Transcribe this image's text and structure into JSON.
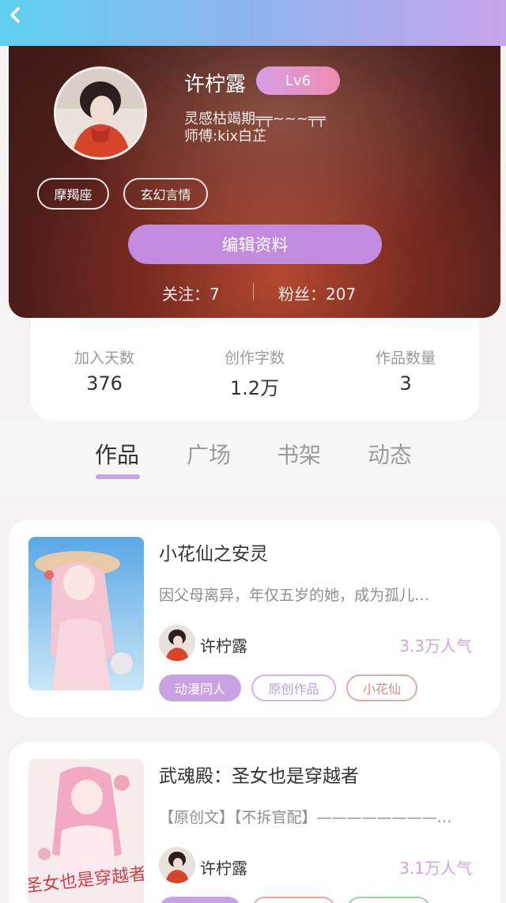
{
  "header": {
    "back_icon": "chevron-left-icon"
  },
  "profile": {
    "nickname": "许柠露",
    "level": "Lv6",
    "bio_line1": "灵感枯竭期╤╤~~~╤╤",
    "bio_line2": "师傅:kix白芷",
    "tags": [
      "摩羯座",
      "玄幻言情"
    ],
    "edit_label": "编辑资料",
    "following": "关注：7",
    "followers": "粉丝：207"
  },
  "stats": [
    {
      "label": "加入天数",
      "value": "376"
    },
    {
      "label": "创作字数",
      "value": "1.2万"
    },
    {
      "label": "作品数量",
      "value": "3"
    }
  ],
  "tabs": [
    "作品",
    "广场",
    "书架",
    "动态"
  ],
  "books": [
    {
      "title": "小花仙之安灵",
      "desc": "因父母离异，年仅五岁的她，成为孤儿…",
      "author": "许柠露",
      "popularity": "3.3万人气",
      "tags": [
        "动漫同人",
        "原创作品",
        "小花仙"
      ]
    },
    {
      "title": "武魂殿：圣女也是穿越者",
      "desc": "【原创文】【不拆官配】————————…",
      "author": "许柠露",
      "popularity": "3.1万人气",
      "cover_text": "圣女也是穿越者"
    }
  ],
  "colors": {
    "accent": "#c38be0",
    "popularity": "#cfa6e2",
    "header_from": "#5fd0ee",
    "header_to": "#c8a4ec"
  }
}
